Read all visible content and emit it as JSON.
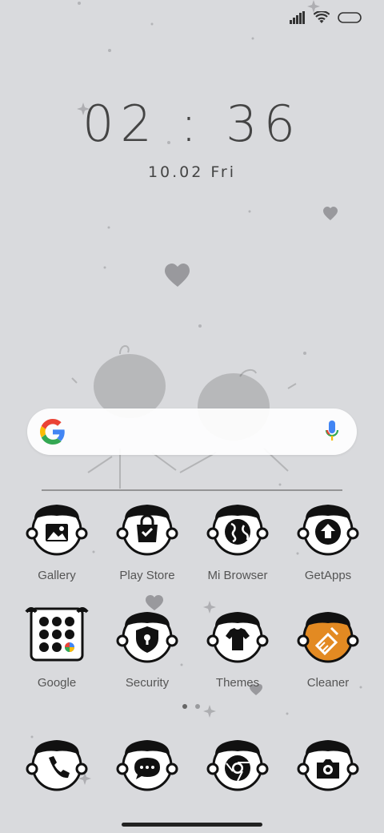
{
  "status": {
    "signal_icon": "signal-icon",
    "wifi_icon": "wifi-icon",
    "battery_icon": "battery-icon"
  },
  "clock": {
    "time": "02 : 36",
    "date": "10.02 Fri"
  },
  "search": {
    "google_icon": "google-g-icon",
    "mic_icon": "mic-icon"
  },
  "apps_row1": [
    {
      "label": "Gallery",
      "icon": "gallery-icon"
    },
    {
      "label": "Play Store",
      "icon": "play-store-icon"
    },
    {
      "label": "Mi Browser",
      "icon": "browser-icon"
    },
    {
      "label": "GetApps",
      "icon": "getapps-icon"
    }
  ],
  "apps_row2": [
    {
      "label": "Google",
      "icon": "google-folder-icon"
    },
    {
      "label": "Security",
      "icon": "security-icon"
    },
    {
      "label": "Themes",
      "icon": "themes-icon"
    },
    {
      "label": "Cleaner",
      "icon": "cleaner-icon"
    }
  ],
  "dock": [
    {
      "icon": "phone-icon"
    },
    {
      "icon": "messages-icon"
    },
    {
      "icon": "chrome-icon"
    },
    {
      "icon": "camera-icon"
    }
  ],
  "colors": {
    "background": "#d9dadd",
    "cleaner_accent": "#e38a22"
  }
}
